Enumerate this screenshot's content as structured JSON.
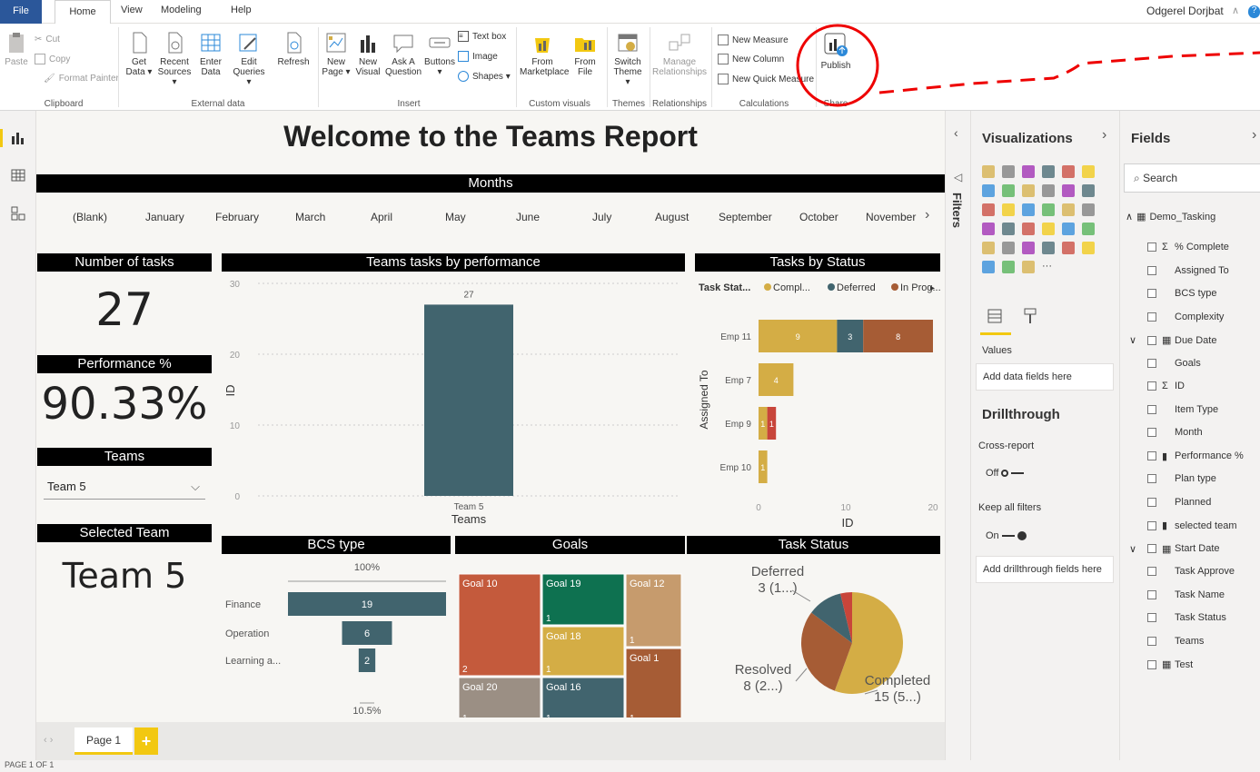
{
  "menu": {
    "file": "File",
    "home": "Home",
    "view": "View",
    "modeling": "Modeling",
    "help": "Help",
    "user": "Odgerel Dorjbat"
  },
  "ribbon": {
    "paste": "Paste",
    "cut": "Cut",
    "copy": "Copy",
    "format_painter": "Format Painter",
    "get_data": "Get Data ▾",
    "recent_sources": "Recent Sources ▾",
    "enter_data": "Enter Data",
    "edit_queries": "Edit Queries ▾",
    "refresh": "Refresh",
    "new_page": "New Page ▾",
    "new_visual": "New Visual",
    "ask_question": "Ask A Question",
    "buttons": "Buttons ▾",
    "text_box": "Text box",
    "image": "Image",
    "shapes": "Shapes ▾",
    "from_marketplace": "From Marketplace",
    "from_file": "From File",
    "switch_theme": "Switch Theme ▾",
    "manage_relationships": "Manage Relationships",
    "new_measure": "New Measure",
    "new_column": "New Column",
    "new_quick_measure": "New Quick Measure",
    "publish": "Publish",
    "groups": {
      "clipboard": "Clipboard",
      "external_data": "External data",
      "insert": "Insert",
      "custom_visuals": "Custom visuals",
      "themes": "Themes",
      "relationships": "Relationships",
      "calculations": "Calculations",
      "share": "Share"
    }
  },
  "report": {
    "title": "Welcome to the Teams Report",
    "months_header": "Months",
    "months": [
      "(Blank)",
      "January",
      "February",
      "March",
      "April",
      "May",
      "June",
      "July",
      "August",
      "September",
      "October",
      "November"
    ],
    "num_tasks_label": "Number of tasks",
    "num_tasks": "27",
    "perf_label": "Performance %",
    "perf": "90.33%",
    "teams_label": "Teams",
    "team_select": "Team 5",
    "selected_team_label": "Selected Team",
    "selected_team": "Team 5",
    "perf_chart_title": "Teams tasks by performance",
    "status_chart_title": "Tasks by Status",
    "bcs_title": "BCS type",
    "goals_title": "Goals",
    "task_status_title": "Task Status"
  },
  "chart_data": [
    {
      "type": "bar",
      "title": "Teams tasks by performance",
      "categories": [
        "Team 5"
      ],
      "values": [
        27
      ],
      "xlabel": "Teams",
      "ylabel": "ID",
      "ylim": [
        0,
        30
      ],
      "yticks": [
        0,
        10,
        20,
        30
      ],
      "color": "#41646e"
    },
    {
      "type": "bar",
      "orientation": "horizontal",
      "stacked": true,
      "title": "Tasks by Status",
      "legend_title": "Task Stat...",
      "categories": [
        "Emp 11",
        "Emp 7",
        "Emp 9",
        "Emp 10"
      ],
      "series": [
        {
          "name": "Compl...",
          "color": "#d4ad45",
          "values": [
            9,
            4,
            1,
            1
          ]
        },
        {
          "name": "Deferred",
          "color": "#41646e",
          "values": [
            3,
            0,
            0,
            0
          ]
        },
        {
          "name": "In Prog...",
          "color": "#a65c35",
          "values": [
            8,
            0,
            1,
            0
          ]
        }
      ],
      "xlabel": "ID",
      "ylabel": "Assigned To",
      "xlim": [
        0,
        20
      ],
      "xticks": [
        0,
        10,
        20
      ],
      "extra_color": "#c8453a"
    },
    {
      "type": "bar",
      "subtype": "funnel",
      "title": "BCS type",
      "categories": [
        "Finance",
        "Operation",
        "Learning a..."
      ],
      "values": [
        19,
        6,
        2
      ],
      "top_label": "100%",
      "bottom_label": "10.5%",
      "color": "#41646e"
    },
    {
      "type": "heatmap",
      "subtype": "treemap",
      "title": "Goals",
      "items": [
        {
          "name": "Goal 10",
          "value": 2,
          "color": "#c45a3c"
        },
        {
          "name": "Goal 19",
          "value": 1,
          "color": "#0e7150"
        },
        {
          "name": "Goal 12",
          "value": 1,
          "color": "#c69b6d"
        },
        {
          "name": "Goal 18",
          "value": 1,
          "color": "#d4ad45"
        },
        {
          "name": "Goal 1",
          "value": 1,
          "color": "#a65c35"
        },
        {
          "name": "Goal 20",
          "value": 1,
          "color": "#9b8f84"
        },
        {
          "name": "Goal 16",
          "value": 1,
          "color": "#41646e"
        }
      ]
    },
    {
      "type": "pie",
      "title": "Task Status",
      "slices": [
        {
          "name": "Completed",
          "label": "15 (5...)",
          "value": 15,
          "color": "#d4ad45"
        },
        {
          "name": "Resolved",
          "label": "8 (2...)",
          "value": 8,
          "color": "#a65c35"
        },
        {
          "name": "Deferred",
          "label": "3 (1...)",
          "value": 3,
          "color": "#41646e"
        },
        {
          "name": "",
          "value": 1,
          "color": "#c8453a"
        }
      ]
    }
  ],
  "panes": {
    "filters": "Filters",
    "visualizations": "Visualizations",
    "fields": "Fields",
    "search": "Search",
    "values": "Values",
    "add_data_fields": "Add data fields here",
    "drillthrough": "Drillthrough",
    "cross_report": "Cross-report",
    "off": "Off",
    "keep_filters": "Keep all filters",
    "on": "On",
    "add_drill_fields": "Add drillthrough fields here",
    "table": "Demo_Tasking",
    "field_list": [
      "% Complete",
      "Assigned To",
      "BCS type",
      "Complexity",
      "Due Date",
      "Goals",
      "ID",
      "Item Type",
      "Month",
      "Performance %",
      "Plan type",
      "Planned",
      "selected team",
      "Start Date",
      "Task Approve",
      "Task Name",
      "Task Status",
      "Teams",
      "Test"
    ]
  },
  "pagebar": {
    "page1": "Page 1",
    "add": "+"
  },
  "status": "PAGE 1 OF 1"
}
